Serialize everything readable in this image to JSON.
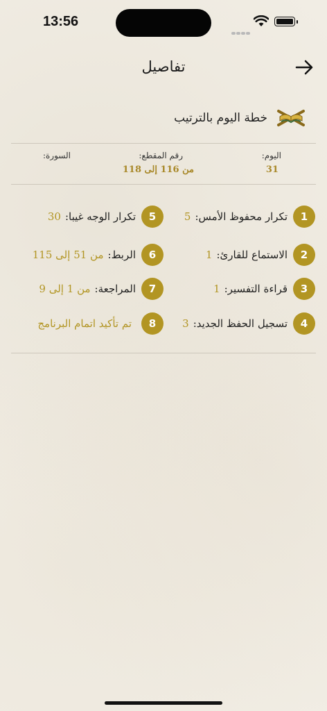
{
  "status_bar": {
    "time": "13:56"
  },
  "nav": {
    "title": "تفاصيل"
  },
  "plan": {
    "title": "خطة اليوم بالترتيب"
  },
  "info": {
    "day_label": "اليوم:",
    "day_value": "31",
    "segment_label": "رقم المقطع:",
    "segment_value": "من 116 إلى 118",
    "surah_label": "السورة:"
  },
  "items": [
    {
      "number": "1",
      "label": "تكرار محفوظ الأمس:",
      "value": "5"
    },
    {
      "number": "2",
      "label": "الاستماع للقارئ:",
      "value": "1"
    },
    {
      "number": "3",
      "label": "قراءة التفسير:",
      "value": "1"
    },
    {
      "number": "4",
      "label": "تسجيل الحفظ الجديد:",
      "value": "3"
    },
    {
      "number": "5",
      "label": "تكرار الوجه غيبا:",
      "value": "30"
    },
    {
      "number": "6",
      "label": "الربط:",
      "value": "من 51 إلى 115"
    },
    {
      "number": "7",
      "label": "المراجعة:",
      "value": "من 1 إلى 9"
    },
    {
      "number": "8",
      "label": "",
      "value": "تم تأكيد اتمام البرنامج"
    }
  ],
  "colors": {
    "accent": "#b29523",
    "value_text": "#a9892a",
    "background": "#f1ede4"
  }
}
